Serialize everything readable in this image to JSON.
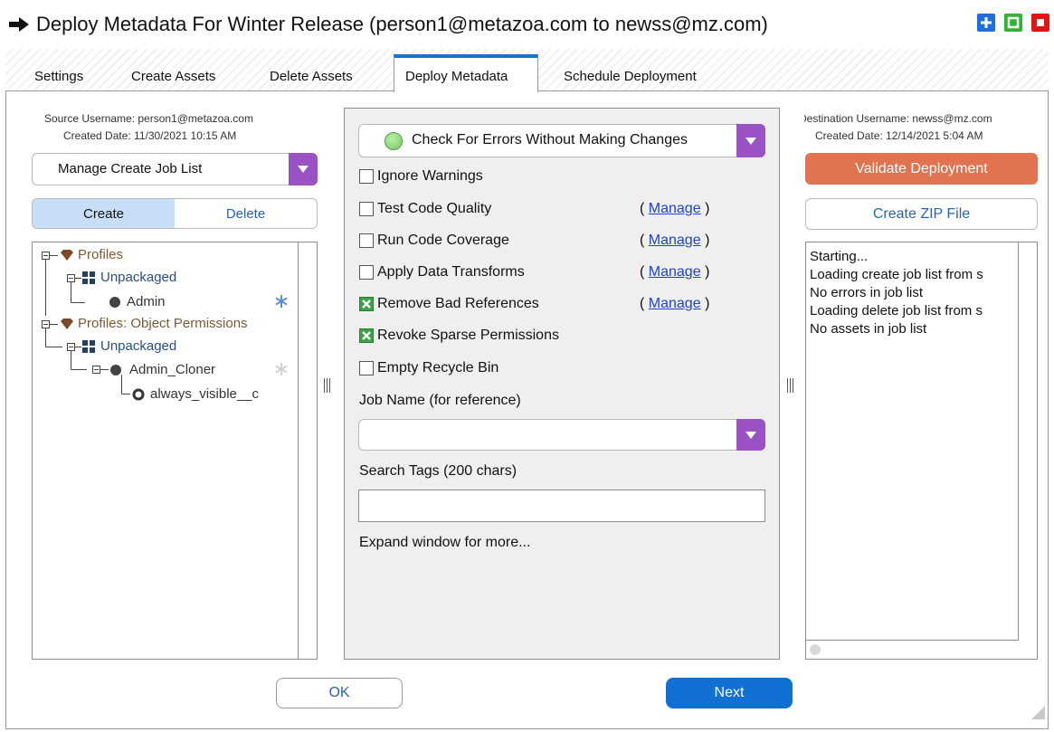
{
  "window": {
    "title": "Deploy Metadata For Winter Release (person1@metazoa.com to newss@mz.com)"
  },
  "tabs": [
    {
      "label": "Settings"
    },
    {
      "label": "Create Assets"
    },
    {
      "label": "Delete Assets"
    },
    {
      "label": "Deploy Metadata"
    },
    {
      "label": "Schedule Deployment"
    }
  ],
  "active_tab": "Deploy Metadata",
  "source": {
    "username": "Source Username: person1@metazoa.com",
    "created": "Created Date: 11/30/2021 10:15 AM",
    "job_list_dropdown": "Manage Create Job List",
    "segment_create": "Create",
    "segment_delete": "Delete"
  },
  "tree": [
    {
      "label": "Profiles",
      "icon": "profile-diamond-icon"
    },
    {
      "label": "Unpackaged",
      "icon": "grid-package-icon"
    },
    {
      "label": "Admin",
      "icon": "dot-icon"
    },
    {
      "label": "Profiles: Object Permissions",
      "icon": "profile-diamond-icon"
    },
    {
      "label": "Unpackaged",
      "icon": "grid-package-icon"
    },
    {
      "label": "Admin_Cloner",
      "icon": "dot-icon"
    },
    {
      "label": "always_visible__c",
      "icon": "ring-icon"
    }
  ],
  "deploy": {
    "mode": "Check For Errors Without Making Changes",
    "options": [
      {
        "label": "Ignore Warnings",
        "checked": false,
        "manage": ""
      },
      {
        "label": "Test Code Quality",
        "checked": false,
        "manage": "Manage"
      },
      {
        "label": "Run Code Coverage",
        "checked": false,
        "manage": "Manage"
      },
      {
        "label": "Apply Data Transforms",
        "checked": false,
        "manage": "Manage"
      },
      {
        "label": "Remove Bad References",
        "checked": true,
        "manage": "Manage"
      },
      {
        "label": "Revoke Sparse Permissions",
        "checked": true,
        "manage": ""
      },
      {
        "label": "Empty Recycle Bin",
        "checked": false,
        "manage": ""
      }
    ],
    "manage_open": "(",
    "manage_close": ")",
    "job_name_label": "Job Name (for reference)",
    "job_name_value": "",
    "search_tags_label": "Search Tags (200 chars)",
    "search_tags_value": "",
    "expand_hint": "Expand window for more..."
  },
  "destination": {
    "username": "Destination Username: newss@mz.com",
    "created": "Created Date: 12/14/2021 5:04 AM",
    "validate_button": "Validate Deployment",
    "zip_button": "Create ZIP File",
    "log": [
      "Starting...",
      "Loading create job list from s",
      "No errors in job list",
      "Loading delete job list from s",
      "No assets in job list"
    ]
  },
  "footer": {
    "ok_label": "OK",
    "next_label": "Next"
  },
  "colors": {
    "accent_blue": "#1070d4",
    "dropdown_purple": "#9b52c4",
    "validate_orange": "#e07350",
    "checked_green": "#3ba14a"
  }
}
